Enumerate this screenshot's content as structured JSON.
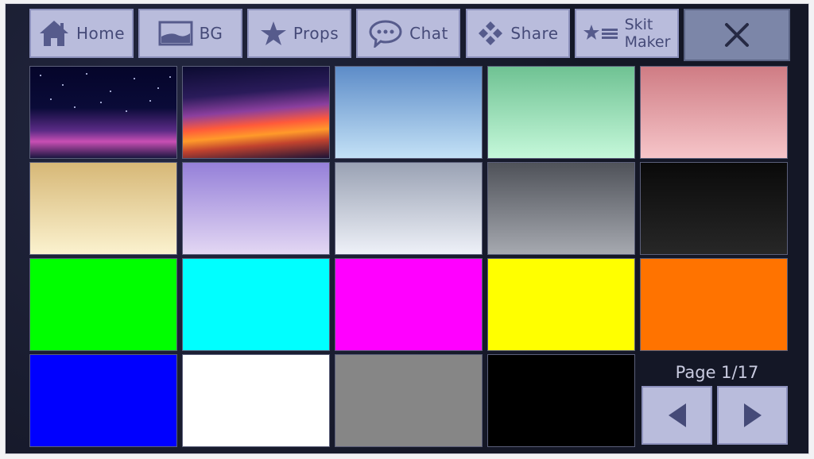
{
  "toolbar": {
    "home_label": "Home",
    "bg_label": "BG",
    "props_label": "Props",
    "chat_label": "Chat",
    "share_label": "Share",
    "skit_maker_label_1": "Skit",
    "skit_maker_label_2": "Maker"
  },
  "icons": {
    "home": "home-icon",
    "bg": "image-icon",
    "props": "star-icon",
    "chat": "speech-bubble-icon",
    "share": "share-diamond-icon",
    "skit_maker": "star-list-icon",
    "close": "close-icon",
    "prev": "chevron-left-icon",
    "next": "chevron-right-icon"
  },
  "backgrounds": [
    {
      "name": "Starry Night",
      "style": "starry-night"
    },
    {
      "name": "Sunset Galaxy",
      "style": "sunset-galaxy"
    },
    {
      "name": "Blue Sky",
      "colors": [
        "#5d8cc8",
        "#c3e1f6"
      ]
    },
    {
      "name": "Mint",
      "colors": [
        "#6fc293",
        "#c5f8da"
      ]
    },
    {
      "name": "Pink",
      "colors": [
        "#cf7c84",
        "#f6c5c9"
      ]
    },
    {
      "name": "Sand",
      "colors": [
        "#d7b877",
        "#fbf2cf"
      ]
    },
    {
      "name": "Lavender",
      "colors": [
        "#9580d9",
        "#e3d7f3"
      ]
    },
    {
      "name": "Silver",
      "colors": [
        "#9aa2b4",
        "#eef1f8"
      ]
    },
    {
      "name": "Steel",
      "colors": [
        "#4f5259",
        "#a6a9b0"
      ]
    },
    {
      "name": "Night Black",
      "colors": [
        "#0a0a0a",
        "#272727"
      ]
    },
    {
      "name": "Green",
      "colors": [
        "#00ff00",
        "#00ff00"
      ]
    },
    {
      "name": "Cyan",
      "colors": [
        "#00ffff",
        "#00ffff"
      ]
    },
    {
      "name": "Magenta",
      "colors": [
        "#ff00ff",
        "#ff00ff"
      ]
    },
    {
      "name": "Yellow",
      "colors": [
        "#ffff00",
        "#ffff00"
      ]
    },
    {
      "name": "Orange",
      "colors": [
        "#ff7300",
        "#ff7300"
      ]
    },
    {
      "name": "Blue",
      "colors": [
        "#0000ff",
        "#0000ff"
      ]
    },
    {
      "name": "White",
      "colors": [
        "#ffffff",
        "#ffffff"
      ]
    },
    {
      "name": "Gray",
      "colors": [
        "#868686",
        "#868686"
      ]
    },
    {
      "name": "Black",
      "colors": [
        "#000000",
        "#000000"
      ]
    }
  ],
  "pager": {
    "page_label": "Page 1/17"
  },
  "colors": {
    "button_bg": "#b9bcdc",
    "button_text": "#454a78",
    "close_bg": "#7c86a8",
    "panel_bg": "#171a28"
  }
}
